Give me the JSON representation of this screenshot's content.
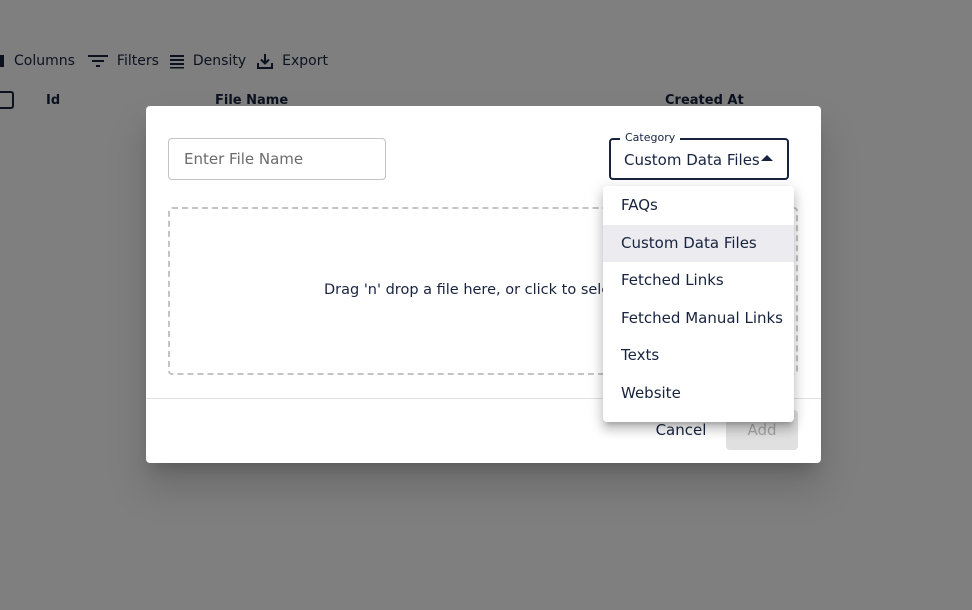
{
  "toolbar": {
    "columns_label": "Columns",
    "filters_label": "Filters",
    "density_label": "Density",
    "export_label": "Export"
  },
  "grid": {
    "columns": [
      "Id",
      "File Name",
      "Created At"
    ]
  },
  "dialog": {
    "file_name_placeholder": "Enter File Name",
    "category": {
      "label": "Category",
      "value": "Custom Data Files",
      "options": [
        "FAQs",
        "Custom Data Files",
        "Fetched Links",
        "Fetched Manual Links",
        "Texts",
        "Website"
      ],
      "selected_index": 1
    },
    "dropzone_text": "Drag 'n' drop a file here, or click to select files",
    "cancel_label": "Cancel",
    "add_label": "Add"
  },
  "colors": {
    "primary_text": "#17233f",
    "backdrop": "rgba(0,0,0,0.5)",
    "selected_option_bg": "#ebebf0",
    "disabled_button_bg": "#e0e0e0"
  }
}
